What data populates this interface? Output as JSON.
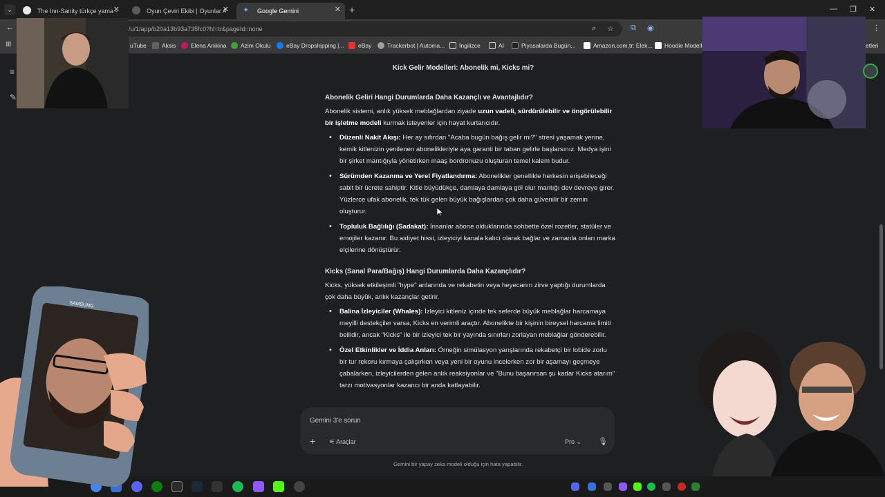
{
  "browser": {
    "tabs": [
      {
        "label": "The Inn-Sanity türkçe yama - G",
        "active": false
      },
      {
        "label": "Oyun Çeviri Ekibi | Oyunlar Artı",
        "active": false
      },
      {
        "label": "Google Gemini",
        "active": true
      }
    ],
    "url": "/u/1/app/b20a13b93a735fc0?hl=tr&pageId=none",
    "bookmarks": [
      "uTube",
      "Aksis",
      "Elena Anikina",
      "Azim Okulu",
      "eBay Dropshipping |...",
      "eBay",
      "Trackerbot | Automa...",
      "İngilizce",
      "AI",
      "Piyasalarda Bugün...",
      "Amazon.com.tr: Elek...",
      "Hoodie Modelle",
      "etleri"
    ]
  },
  "content": {
    "title": "Kick Gelir Modelleri: Abonelik mi, Kicks mi?",
    "sec1": {
      "heading": "Abonelik Geliri Hangi Durumlarda Daha Kazançlı ve Avantajlıdır?",
      "intro_a": "Abonelik sistemi, anlık yüksek meblağlardan ziyade ",
      "intro_b": "uzun vadeli, sürdürülebilir ve öngörülebilir bir işletme modeli",
      "intro_c": " kurmak isteyenler için hayat kurtarıcıdır.",
      "items": [
        {
          "bold": "Düzenli Nakit Akışı:",
          "text": " Her ay sıfırdan \"Acaba bugün bağış gelir mi?\" stresi yaşamak yerine, kemik kitlenizin yenilenen abonelikleriyle aya garanti bir taban gelirle başlarsınız. Medya işini bir şirket mantığıyla yönetirken maaş bordronuzu oluşturan temel kalem budur."
        },
        {
          "bold": "Sürümden Kazanma ve Yerel Fiyatlandırma:",
          "text": " Abonelikler genellikle herkesin erişebileceği sabit bir ücrete sahiptir. Kitle büyüdükçe, damlaya damlaya göl olur mantığı dev devreye girer. Yüzlerce ufak abonelik, tek tük gelen büyük bağışlardan çok daha güvenilir bir zemin oluşturur."
        },
        {
          "bold": "Topluluk Bağlılığı (Sadakat):",
          "text": " İnsanlar abone olduklarında sohbette özel rozetler, statüler ve emojiler kazanır. Bu aidiyet hissi, izleyiciyi kanala kalıcı olarak bağlar ve zamanla onları marka elçilerine dönüştürür."
        }
      ]
    },
    "sec2": {
      "heading": "Kicks (Sanal Para/Bağış) Hangi Durumlarda Daha Kazançlıdır?",
      "intro": "Kicks, yüksek etkileşimli \"hype\" anlarında ve rekabetin veya heyecanın zirve yaptığı durumlarda çok daha büyük, anlık kazançlar getirir.",
      "items": [
        {
          "bold": "Balina İzleyiciler (Whales):",
          "text": " İzleyici kitleniz içinde tek seferde büyük meblağlar harcamaya meyilli destekçiler varsa, Kicks en verimli araçtır. Abonelikte bir kişinin bireysel harcama limiti bellidir, ancak \"Kicks\" ile bir izleyici tek bir yayında sınırları zorlayan meblağlar gönderebilir."
        },
        {
          "bold": "Özel Etkinlikler ve İddia Anları:",
          "text": " Örneğin simülasyon yarışlarında rekabetçi bir lobide zorlu bir tur rekoru kırmaya çalışırken veya yeni bir oyunu incelerken zor bir aşamayı geçmeye çabalarken, izleyicilerden gelen anlık reaksiyonlar ve \"Bunu başarırsan şu kadar Kicks atarım\" tarzı motivasyonlar kazancı bir anda katlayabilir."
        }
      ]
    }
  },
  "composer": {
    "placeholder": "Gemini 3'e sorun",
    "tools_label": "Araçlar",
    "model_label": "Pro",
    "disclaimer": "Gemini bir yapay zeka modeli olduğu için hata yapabilir."
  },
  "phone": {
    "brand": "SAMSUNG"
  },
  "colors": {
    "tab_active": "#3a3a3a",
    "page_bg": "#1e1f20",
    "composer_bg": "#282a2c",
    "gemini_accent": "#4285f4"
  }
}
